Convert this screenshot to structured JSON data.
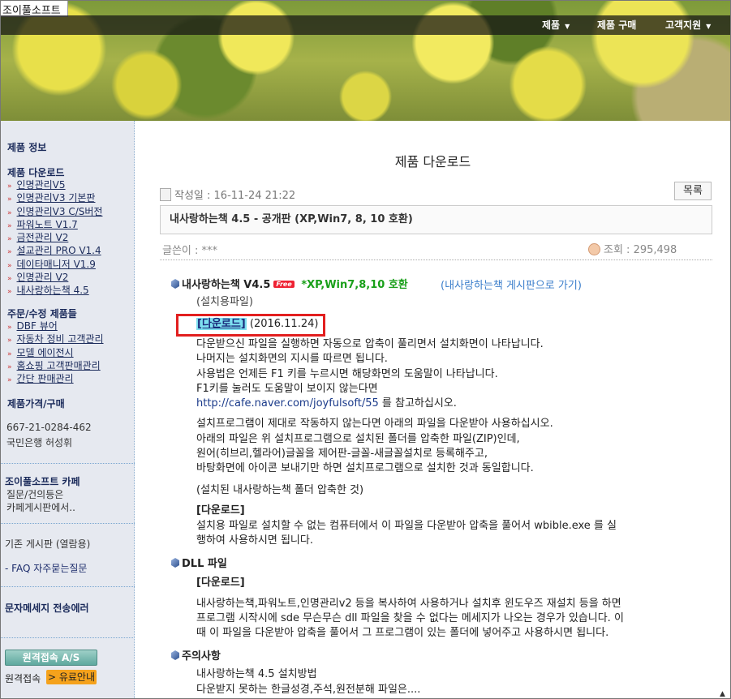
{
  "header": {
    "logo": "조이풀소프트",
    "nav": [
      {
        "label": "제품",
        "has_caret": true
      },
      {
        "label": "제품 구매",
        "has_caret": false
      },
      {
        "label": "고객지원",
        "has_caret": true
      }
    ]
  },
  "sidebar": {
    "product_info": "제품 정보",
    "download_heading": "제품 다운로드",
    "download_items": [
      "인명관리V5",
      "인명관리V3 기본판",
      "인명관리V3 C/S버전",
      "파워노트 V1.7",
      "금전관리 V2",
      "설교관리 PRO V1.4",
      "데이타매니저 V1.9",
      "인명관리 V2",
      "내사랑하는책 4.5"
    ],
    "order_heading": "주문/수정 제품들",
    "order_items": [
      "DBF 뷰어",
      "자동차 정비 고객관리",
      "모델 에이전시",
      "홈쇼핑 고객판매관리",
      "간단 판매관리"
    ],
    "price_heading": "제품가격/구매",
    "account_number": "667-21-0284-462",
    "account_bank": "국민은행  허성휘",
    "cafe_heading": "조이풀소프트 카페",
    "cafe_line1": "질문/건의등은",
    "cafe_line2": "카페게시판에서..",
    "old_board": "기존 게시판 (열람용)",
    "faq": "- FAQ 자주묻는질문",
    "sms_error": "문자메세지 전송에러",
    "as_button": "원격접속 A/S",
    "remote_label": "원격접속",
    "paid_button": "> 유료안내"
  },
  "main": {
    "page_title": "제품 다운로드",
    "date_label": "작성일 : 16-11-24 21:22",
    "list_button": "목록",
    "post_title": "내사랑하는책 4.5 - 공개판 (XP,Win7, 8, 10 호환)",
    "author": "글쓴이 : ***",
    "views": "조회 : 295,498",
    "section1": {
      "title": "내사랑하는책 V4.5",
      "free_badge": "Free",
      "compat": "*XP,Win7,8,10 호환",
      "board_link": "(내사랑하는책 게시판으로 가기)",
      "install_file_label": "(설치용파일)",
      "download_link": "[다운로드]",
      "download_date": " (2016.11.24)",
      "para1": [
        "다운받으신 파일을 실행하면 자동으로 압축이 풀리면서 설치화면이 나타납니다.",
        "나머지는 설치화면의 지시를 따르면 됩니다.",
        "사용법은 언제든 F1 키를 누르시면 해당화면의 도움말이 나타납니다.",
        "F1키를 눌러도 도움말이 보이지 않는다면"
      ],
      "cafe_url": "http://cafe.naver.com/joyfulsoft/55",
      "cafe_suffix": " 를 참고하십시오.",
      "para2": [
        "설치프로그램이 제대로 작동하지 않는다면 아래의 파일을 다운받아 사용하십시오.",
        "아래의 파일은 위 설치프로그램으로 설치된 폴더를 압축한 파일(ZIP)인데,",
        "원어(히브리,헬라어)글꼴을 제어판-글꼴-새글꼴설치로 등록해주고,",
        "바탕화면에 아이콘 보내기만 하면 설치프로그램으로 설치한 것과 동일합니다."
      ],
      "zip_label": "(설치된 내사랑하는책 폴더 압축한 것)",
      "zip_download": "[다운로드]",
      "zip_desc": [
        "설치용 파일로 설치할 수 없는 컴퓨터에서 이 파일을 다운받아 압축을 풀어서 wbible.exe 를 실",
        "행하여 사용하시면 됩니다."
      ]
    },
    "section2": {
      "title": "DLL 파일",
      "download": "[다운로드]",
      "desc": [
        "내사랑하는책,파워노트,인명관리v2 등을 복사하여 사용하거나 설치후 윈도우즈 재설치 등을 하면",
        "프로그램 시작시에 sde 무슨무슨 dll 파일을 찾을 수 없다는 메세지가 나오는 경우가 있습니다. 이",
        "때 이 파일을 다운받아 압축을 풀어서 그 프로그램이 있는 폴더에 넣어주고 사용하시면 됩니다."
      ]
    },
    "section3": {
      "title": "주의사항",
      "links": [
        "내사랑하는책 4.5 설치방법",
        "다운받지 못하는 한글성경,주석,원전분해 파일은...."
      ]
    }
  }
}
